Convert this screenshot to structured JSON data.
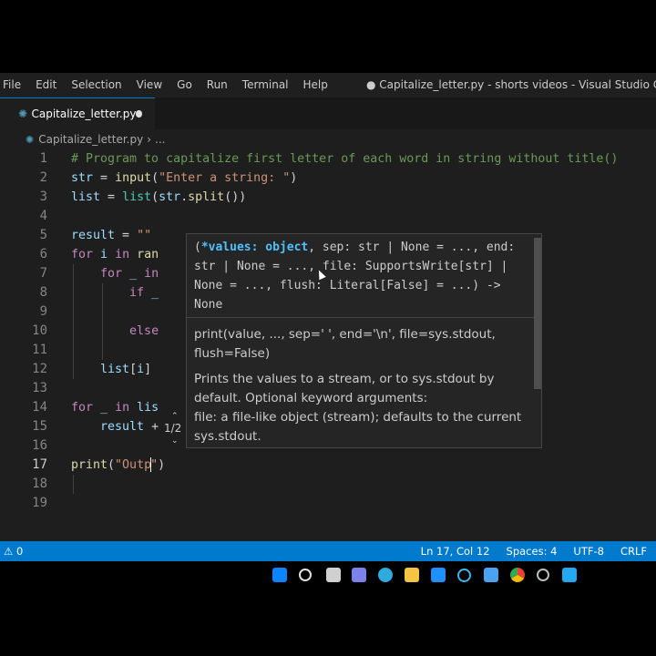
{
  "menu": {
    "items": [
      "File",
      "Edit",
      "Selection",
      "View",
      "Go",
      "Run",
      "Terminal",
      "Help"
    ],
    "window_title": "● Capitalize_letter.py - shorts videos - Visual Studio Code"
  },
  "tab": {
    "label": "Capitalize_letter.py",
    "icon": "python-file-icon",
    "modified": true
  },
  "breadcrumb": {
    "file": "Capitalize_letter.py",
    "more": "..."
  },
  "editor": {
    "line_numbers": [
      "1",
      "2",
      "3",
      "4",
      "5",
      "6",
      "7",
      "8",
      "9",
      "10",
      "11",
      "12",
      "13",
      "14",
      "15",
      "16",
      "17",
      "18",
      "19"
    ],
    "active_line": "17",
    "lines": [
      "# Program to capitalize first letter of each word in string without title()",
      "str = input(\"Enter a string: \")",
      "list = list(str.split())",
      "",
      "result = \"\"",
      "for i in ran",
      "    for _ in",
      "        if _",
      "",
      "        else",
      "",
      "    list[i]",
      "",
      "for _ in lis",
      "    result +",
      "",
      "print(\"Outp\")",
      "",
      ""
    ]
  },
  "hover": {
    "signature_active": "*values: object",
    "signature_open": "(",
    "signature_rest": ", sep: str | None = ..., end: str | None = ..., file: SupportsWrite[str] | None = ..., flush: Literal[False] = ...) -> None",
    "doc_signature": "print(value, ..., sep=' ', end='\\n', file=sys.stdout, flush=False)",
    "doc_description": "Prints the values to a stream, or to sys.stdout by default. Optional keyword arguments:",
    "doc_param": "file: a file-like object (stream); defaults to the current sys.stdout.",
    "overload": "1/2"
  },
  "status": {
    "problems": "0",
    "position": "Ln 17, Col 12",
    "spaces": "Spaces: 4",
    "encoding": "UTF-8",
    "eol": "CRLF"
  },
  "taskbar": {
    "icons": [
      "windows-start-icon",
      "search-icon",
      "task-view-icon",
      "teams-chat-icon",
      "edge-icon",
      "file-explorer-icon",
      "mail-icon",
      "cortana-icon",
      "store-icon",
      "chrome-icon",
      "settings-icon",
      "vscode-icon"
    ]
  },
  "colors": {
    "accent": "#007acc",
    "editor_bg": "#1e1e1e",
    "keyword": "#c586c0",
    "string": "#ce9178",
    "comment": "#6a9955"
  }
}
